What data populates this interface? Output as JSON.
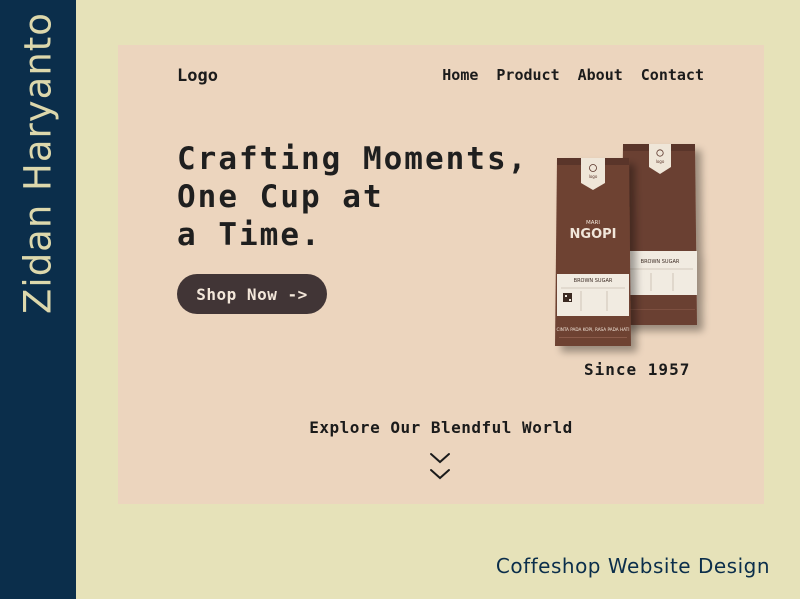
{
  "author": "Zidan Haryanto",
  "caption": "Coffeshop Website Design",
  "header": {
    "logo": "Logo",
    "nav": [
      "Home",
      "Product",
      "About",
      "Contact"
    ]
  },
  "hero": {
    "headline_lines": [
      "Crafting Moments,",
      "One Cup at",
      "a Time."
    ],
    "cta_label": "Shop Now ->",
    "since": "Since 1957"
  },
  "product": {
    "back_bag_label": "BROWN SUGAR",
    "front_bag_brand_small": "MARI",
    "front_bag_brand": "NGOPI",
    "front_bag_label": "BROWN SUGAR",
    "front_bag_footer": "CINTA PADA KOPI, RASA PADA HATI",
    "bag_logo": "logo"
  },
  "explore": {
    "label": "Explore Our Blendful World",
    "icon": "double-chevron-down-icon"
  },
  "colors": {
    "page_bg": "#e6e2b9",
    "side_band": "#0b2e4b",
    "frame_bg": "#ecd5be",
    "button_bg": "#413536",
    "bag_brown": "#6a3f32"
  }
}
